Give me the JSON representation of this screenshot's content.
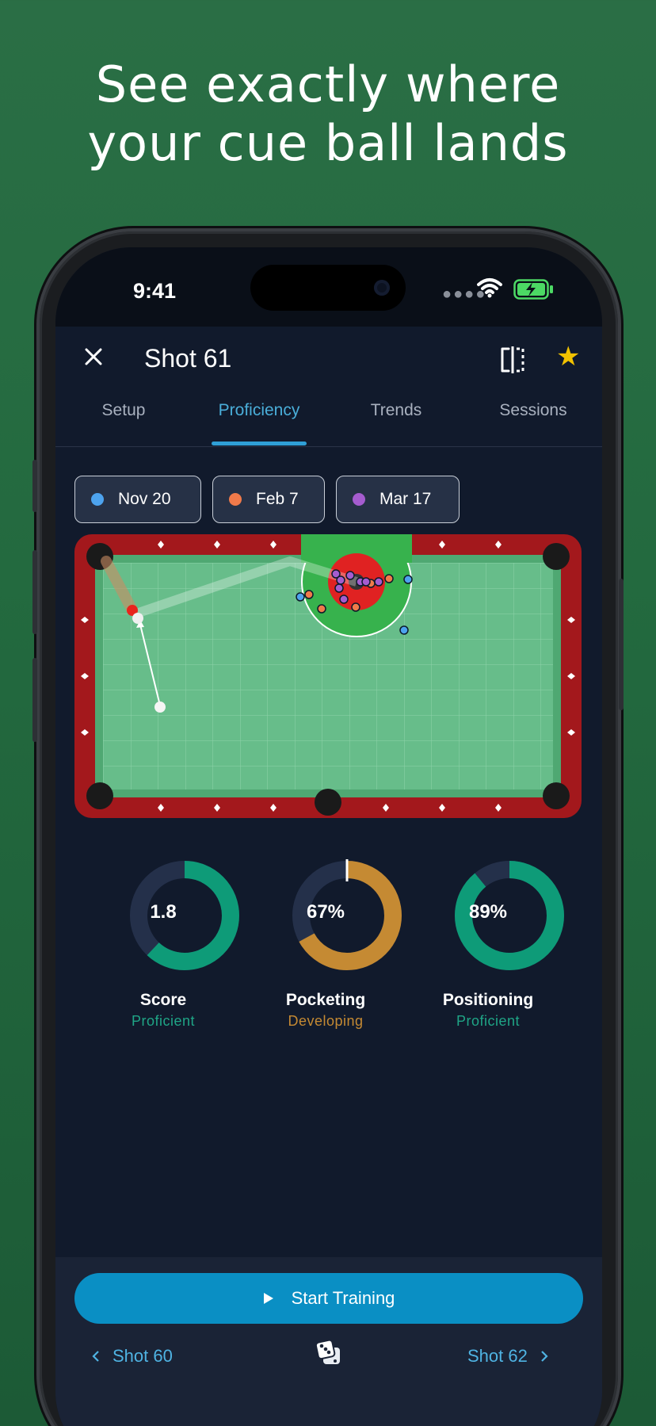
{
  "headline": {
    "line1": "See exactly where",
    "line2": "your cue ball lands"
  },
  "status_bar": {
    "time": "9:41",
    "icons": [
      "signal-dots-icon",
      "wifi-icon",
      "battery-charging-icon"
    ]
  },
  "header": {
    "close_icon": "close-icon",
    "title": "Shot 61",
    "compare_icon": "compare-split-icon",
    "favorite_icon": "star-icon",
    "favorite_color": "#f2c200"
  },
  "tabs": [
    {
      "label": "Setup",
      "active": false
    },
    {
      "label": "Proficiency",
      "active": true
    },
    {
      "label": "Trends",
      "active": false
    },
    {
      "label": "Sessions",
      "active": false
    }
  ],
  "sessions": [
    {
      "label": "Nov 20",
      "color": "#4da3ee"
    },
    {
      "label": "Feb 7",
      "color": "#f07a4a"
    },
    {
      "label": "Mar 17",
      "color": "#a55ccf"
    }
  ],
  "metrics": [
    {
      "value": "1.8",
      "label": "Score",
      "status": "Proficient",
      "fraction": 0.62,
      "color": "#0e9b78",
      "status_color": "#1fa586"
    },
    {
      "value": "67%",
      "label": "Pocketing",
      "status": "Developing",
      "fraction": 0.67,
      "color": "#c58a33",
      "status_color": "#c58a33"
    },
    {
      "value": "89%",
      "label": "Positioning",
      "status": "Proficient",
      "fraction": 0.89,
      "color": "#0e9b78",
      "status_color": "#1fa586"
    }
  ],
  "actions": {
    "start_label": "Start Training",
    "prev_label": "Shot 60",
    "next_label": "Shot 62",
    "random_icon": "dice-icon"
  },
  "colors": {
    "accent": "#0a8fc4",
    "felt": "#67bd8a",
    "rail": "#a3181c",
    "target_green": "#37b24d",
    "target_red": "#e02222"
  }
}
